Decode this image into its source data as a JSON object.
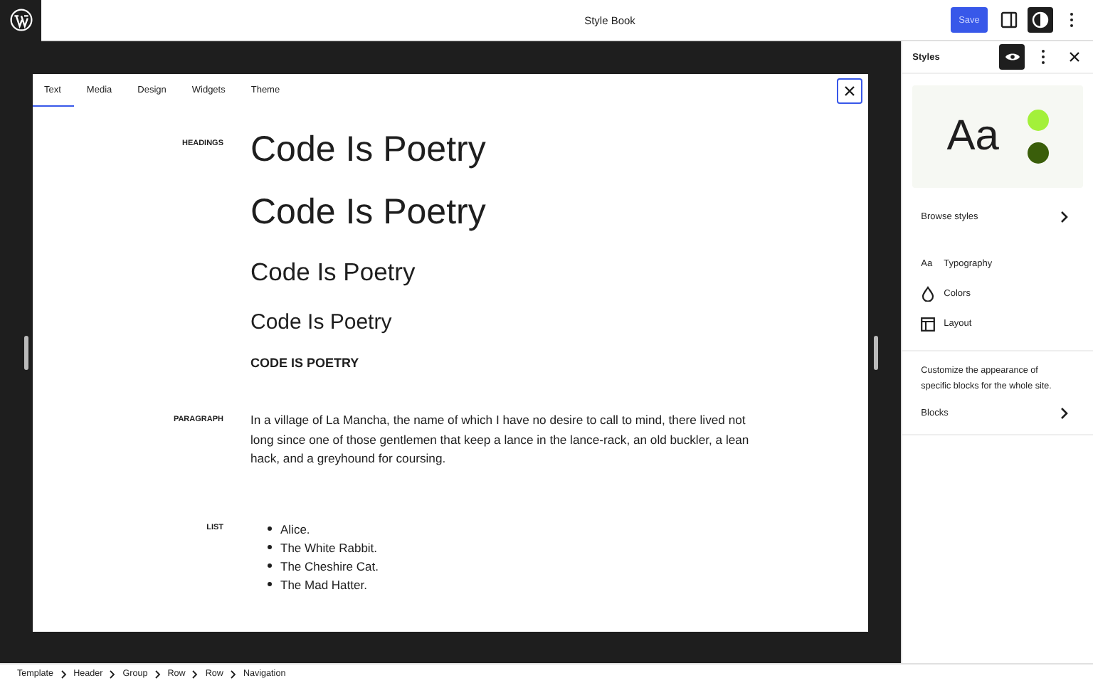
{
  "header": {
    "title": "Style Book",
    "save_button": "Save",
    "styles_toggle_selected": true
  },
  "style_book": {
    "tabs": [
      {
        "label": "Text",
        "selected": true
      },
      {
        "label": "Media",
        "selected": false
      },
      {
        "label": "Design",
        "selected": false
      },
      {
        "label": "Widgets",
        "selected": false
      },
      {
        "label": "Theme",
        "selected": false
      }
    ],
    "sections": [
      {
        "kind": "headings",
        "label": "HEADINGS",
        "items": [
          "Code Is Poetry",
          "Code Is Poetry",
          "Code Is Poetry",
          "Code Is Poetry",
          "CODE IS POETRY"
        ]
      },
      {
        "kind": "paragraph",
        "label": "PARAGRAPH",
        "text": "In a village of La Mancha, the name of which I have no desire to call to mind, there lived not long since one of those gentlemen that keep a lance in the lance-rack, an old buckler, a lean hack, and a greyhound for coursing."
      },
      {
        "kind": "list",
        "label": "LIST",
        "items": [
          "Alice.",
          "The White Rabbit.",
          "The Cheshire Cat.",
          "The Mad Hatter."
        ]
      }
    ]
  },
  "sidebar": {
    "title": "Styles",
    "preview": {
      "sample": "Aa",
      "swatches": [
        {
          "color": "#a3f03a"
        },
        {
          "color": "#3a5e0a"
        }
      ]
    },
    "browse": "Browse styles",
    "items": [
      {
        "kind": "typography",
        "icon": "Aa",
        "label": "Typography"
      },
      {
        "kind": "colors",
        "label": "Colors"
      },
      {
        "kind": "layout",
        "label": "Layout"
      }
    ],
    "blocks_description": "Customize the appearance of specific blocks for the whole site.",
    "blocks": "Blocks"
  },
  "breadcrumbs": [
    "Template",
    "Header",
    "Group",
    "Row",
    "Row",
    "Navigation"
  ]
}
